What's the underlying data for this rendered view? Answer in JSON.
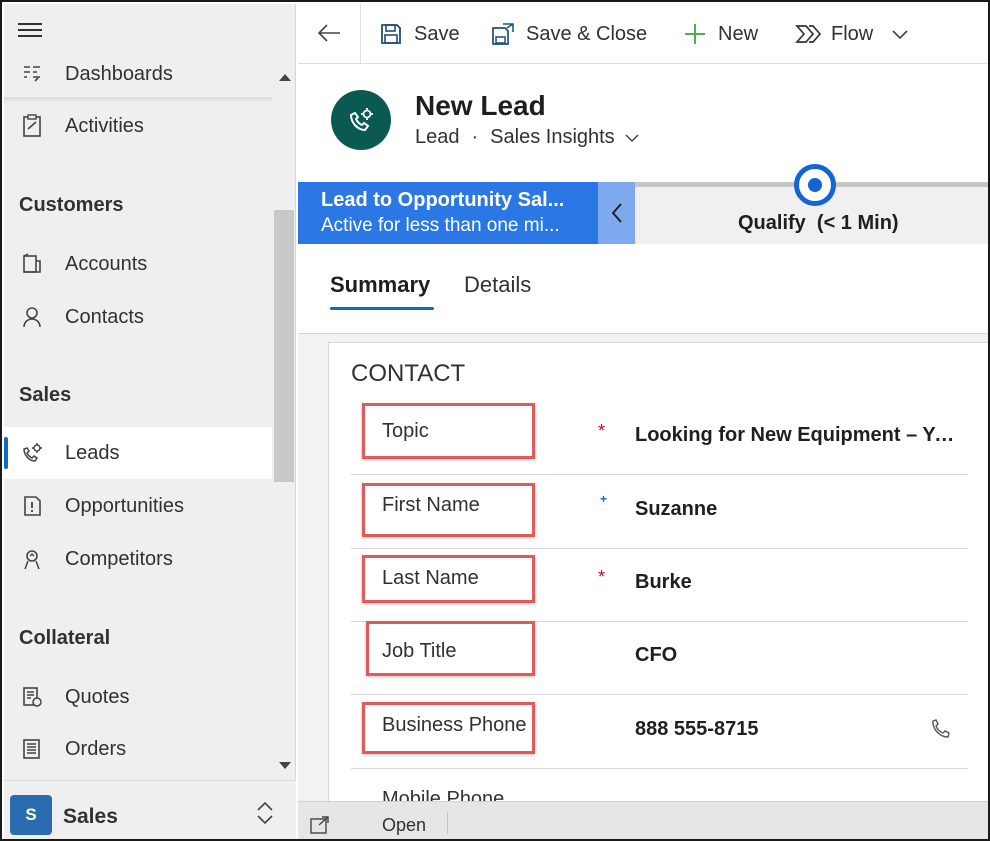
{
  "sidebar": {
    "items": [
      {
        "label": "Dashboards",
        "icon": "dashboard-icon"
      },
      {
        "label": "Activities",
        "icon": "clipboard-icon"
      },
      {
        "label": "Accounts",
        "icon": "building-icon"
      },
      {
        "label": "Contacts",
        "icon": "person-icon"
      },
      {
        "label": "Leads",
        "icon": "lead-phone-gear-icon"
      },
      {
        "label": "Opportunities",
        "icon": "opportunity-icon"
      },
      {
        "label": "Competitors",
        "icon": "competitor-icon"
      },
      {
        "label": "Quotes",
        "icon": "quote-icon"
      },
      {
        "label": "Orders",
        "icon": "order-icon"
      }
    ],
    "sections": {
      "customers": "Customers",
      "sales": "Sales",
      "collateral": "Collateral"
    },
    "active_item": "Leads",
    "area": {
      "badge": "S",
      "label": "Sales"
    }
  },
  "toolbar": {
    "save": "Save",
    "save_close": "Save & Close",
    "new": "New",
    "flow": "Flow"
  },
  "header": {
    "title": "New Lead",
    "entity": "Lead",
    "separator": "·",
    "form": "Sales Insights"
  },
  "bpf": {
    "process_name": "Lead to Opportunity Sal...",
    "status": "Active for less than one mi...",
    "stage": "Qualify  (< 1 Min)"
  },
  "tabs": [
    {
      "label": "Summary",
      "active": true
    },
    {
      "label": "Details",
      "active": false
    }
  ],
  "section": {
    "title": "CONTACT",
    "fields": [
      {
        "label": "Topic",
        "required": "*",
        "value": "Looking for New Equipment – Yo..."
      },
      {
        "label": "First Name",
        "recommended": "+",
        "value": "Suzanne"
      },
      {
        "label": "Last Name",
        "required": "*",
        "value": "Burke"
      },
      {
        "label": "Job Title",
        "value": "CFO"
      },
      {
        "label": "Business Phone",
        "value": "888 555-8715"
      },
      {
        "label": "Mobile Phone",
        "value": ""
      }
    ]
  },
  "footer": {
    "status": "Open"
  },
  "colors": {
    "accent": "#0f6cbd",
    "bpf_active": "#2b78e4",
    "highlight": "#e05a5a",
    "avatar": "#0b5a52"
  }
}
